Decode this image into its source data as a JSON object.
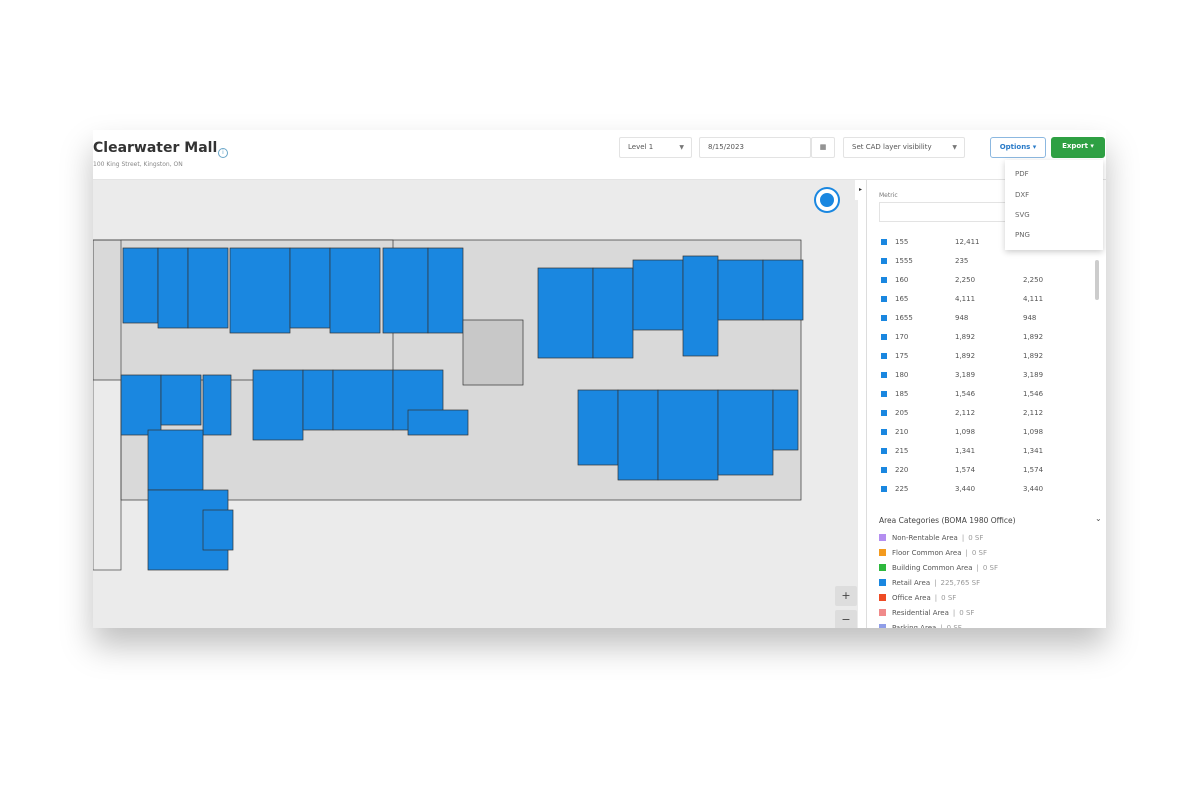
{
  "header": {
    "title": "Clearwater Mall",
    "address": "100 King Street, Kingston, ON",
    "level": "Level 1",
    "date": "8/15/2023",
    "cad_layer": "Set CAD layer visibility",
    "options": "Options",
    "export": "Export"
  },
  "export_menu": [
    "PDF",
    "DXF",
    "SVG",
    "PNG"
  ],
  "panel": {
    "metric_label": "Metric",
    "rows": [
      [
        "155",
        "12,411",
        ""
      ],
      [
        "1555",
        "235",
        ""
      ],
      [
        "160",
        "2,250",
        "2,250"
      ],
      [
        "165",
        "4,111",
        "4,111"
      ],
      [
        "1655",
        "948",
        "948"
      ],
      [
        "170",
        "1,892",
        "1,892"
      ],
      [
        "175",
        "1,892",
        "1,892"
      ],
      [
        "180",
        "3,189",
        "3,189"
      ],
      [
        "185",
        "1,546",
        "1,546"
      ],
      [
        "205",
        "2,112",
        "2,112"
      ],
      [
        "210",
        "1,098",
        "1,098"
      ],
      [
        "215",
        "1,341",
        "1,341"
      ],
      [
        "220",
        "1,574",
        "1,574"
      ],
      [
        "225",
        "3,440",
        "3,440"
      ]
    ],
    "categories_title": "Area Categories (BOMA 1980 Office)",
    "categories": [
      {
        "name": "Non-Rentable Area",
        "value": "0 SF",
        "color": "#b48ef0"
      },
      {
        "name": "Floor Common Area",
        "value": "0 SF",
        "color": "#f39a1e"
      },
      {
        "name": "Building Common Area",
        "value": "0 SF",
        "color": "#2db83d"
      },
      {
        "name": "Retail Area",
        "value": "225,765 SF",
        "color": "#1a87e0"
      },
      {
        "name": "Office Area",
        "value": "0 SF",
        "color": "#ee4b25"
      },
      {
        "name": "Residential Area",
        "value": "0 SF",
        "color": "#f08a8a"
      },
      {
        "name": "Parking Area",
        "value": "0 SF",
        "color": "#8f9de8"
      }
    ]
  },
  "map": {
    "zoom_in": "+",
    "zoom_out": "−"
  }
}
